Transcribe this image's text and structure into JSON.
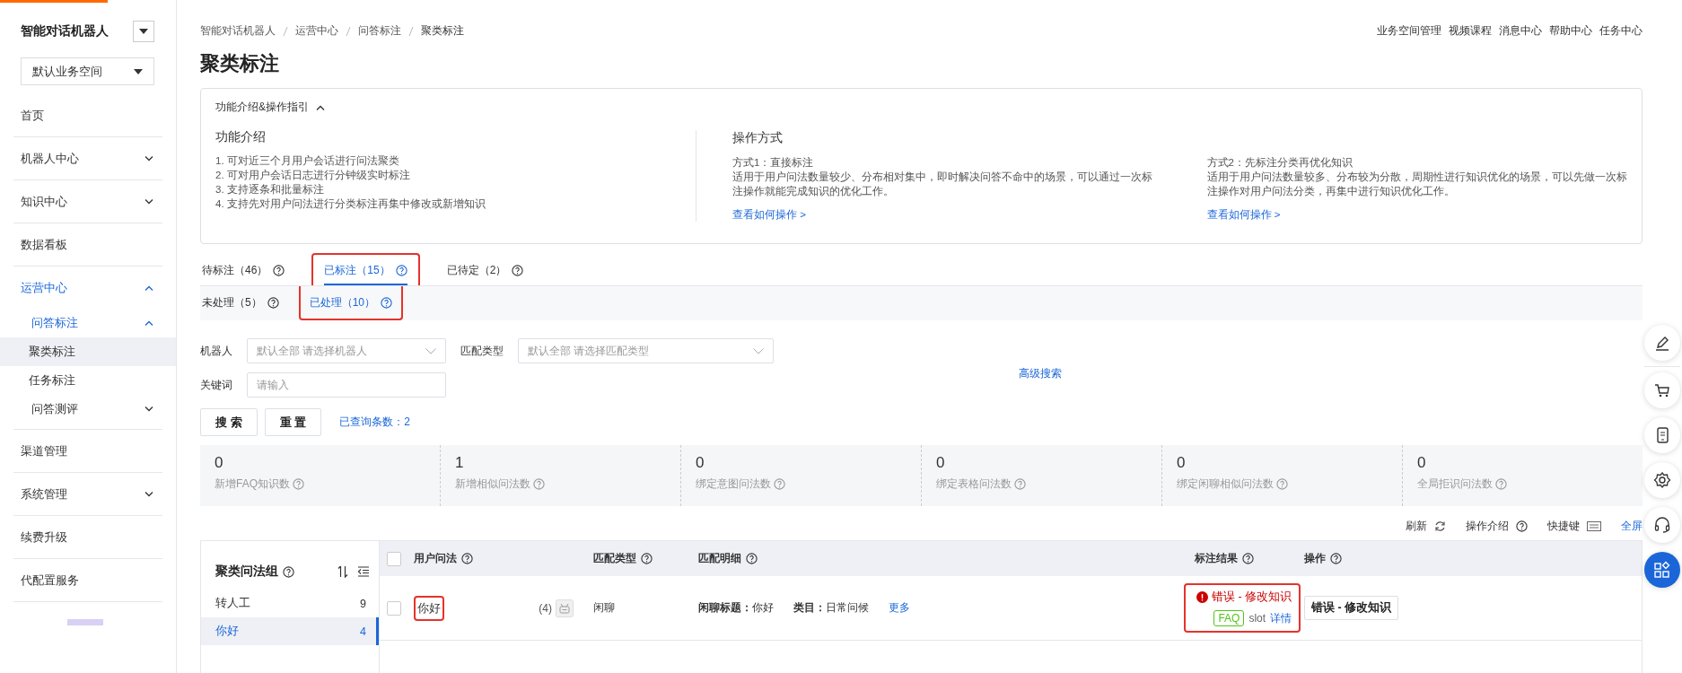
{
  "sidebar": {
    "title": "智能对话机器人",
    "workspace": "默认业务空间",
    "items": [
      {
        "label": "首页",
        "selected": false
      },
      {
        "label": "机器人中心",
        "selected": false,
        "expanded": false
      },
      {
        "label": "知识中心",
        "selected": false,
        "expanded": false
      },
      {
        "label": "数据看板",
        "selected": false
      },
      {
        "label": "运营中心",
        "selected": false,
        "expanded": true,
        "children": [
          {
            "label": "问答标注",
            "selected": false,
            "expanded": true,
            "children": [
              {
                "label": "聚类标注",
                "selected": true
              },
              {
                "label": "任务标注",
                "selected": false
              }
            ]
          },
          {
            "label": "问答测评",
            "selected": false,
            "expanded": false
          }
        ]
      },
      {
        "label": "渠道管理",
        "selected": false
      },
      {
        "label": "系统管理",
        "selected": false,
        "expanded": false
      },
      {
        "label": "续费升级",
        "selected": false
      },
      {
        "label": "代配置服务",
        "selected": false
      }
    ]
  },
  "header": {
    "breadcrumb": [
      "智能对话机器人",
      "运营中心",
      "问答标注",
      "聚类标注"
    ],
    "links": [
      "业务空间管理",
      "视频课程",
      "消息中心",
      "帮助中心",
      "任务中心"
    ],
    "title": "聚类标注"
  },
  "intro": {
    "toggle": "功能介绍&操作指引",
    "expanded": true,
    "features": {
      "title": "功能介绍",
      "lines": [
        "1. 可对近三个月用户会话进行问法聚类",
        "2. 可对用户会话日志进行分钟级实时标注",
        "3. 支持逐条和批量标注",
        "4. 支持先对用户问法进行分类标注再集中修改或新增知识"
      ]
    },
    "operations": {
      "title": "操作方式",
      "methods": [
        {
          "name": "方式1：直接标注",
          "description": "适用于用户问法数量较少、分布相对集中，即时解决问答不命中的场景，可以通过一次标注操作就能完成知识的优化工作。",
          "link": "查看如何操作 >"
        },
        {
          "name": "方式2：先标注分类再优化知识",
          "description": "适用于用户问法数量较多、分布较为分散，周期性进行知识优化的场景，可以先做一次标注操作对用户问法分类，再集中进行知识优化工作。",
          "link": "查看如何操作 >"
        }
      ]
    }
  },
  "tabs": [
    {
      "label": "待标注（46）",
      "selected": false,
      "highlighted": false
    },
    {
      "label": "已标注（15）",
      "selected": true,
      "highlighted": true
    },
    {
      "label": "已待定（2）",
      "selected": false,
      "highlighted": false
    }
  ],
  "subtabs": [
    {
      "label": "未处理（5）",
      "selected": false,
      "highlighted": false
    },
    {
      "label": "已处理（10）",
      "selected": true,
      "highlighted": true
    }
  ],
  "filters": [
    {
      "kind": "select",
      "label": "机器人",
      "placeholder": "默认全部 请选择机器人"
    },
    {
      "kind": "select",
      "label": "匹配类型",
      "placeholder": "默认全部 请选择匹配类型"
    },
    {
      "kind": "text",
      "label": "关键词",
      "placeholder": "请输入"
    }
  ],
  "advanced_search": "高级搜索",
  "buttons": [
    "搜 索",
    "重 置"
  ],
  "result_count": "已查询条数：2",
  "stats": [
    {
      "value": "0",
      "label": "新增FAQ知识数"
    },
    {
      "value": "1",
      "label": "新增相似问法数"
    },
    {
      "value": "0",
      "label": "绑定意图问法数"
    },
    {
      "value": "0",
      "label": "绑定表格问法数"
    },
    {
      "value": "0",
      "label": "绑定闲聊相似问法数"
    },
    {
      "value": "0",
      "label": "全局拒识问法数"
    }
  ],
  "toolbar": [
    {
      "kind": "refresh",
      "label": "刷新"
    },
    {
      "kind": "help",
      "label": "操作介绍"
    },
    {
      "kind": "keyboard",
      "label": "快捷键"
    },
    {
      "kind": "link",
      "label": "全屏"
    }
  ],
  "groups": {
    "title": "聚类问法组",
    "items": [
      {
        "label": "转人工",
        "count": "9",
        "selected": false
      },
      {
        "label": "你好",
        "count": "4",
        "selected": true
      }
    ]
  },
  "table": {
    "all_checked": false,
    "columns": [
      "用户问法",
      "匹配类型",
      "匹配明细",
      "标注结果",
      "操作"
    ],
    "rows": [
      {
        "checked": false,
        "question": "你好",
        "question_highlighted": true,
        "similar_count": "(4)",
        "match_type": "闲聊",
        "details": [
          "**闲聊标题：**你好",
          "**类目：**日常问候"
        ],
        "more": "更多",
        "result": {
          "kind": "error",
          "status": "错误 - 修改知识",
          "tag": "FAQ",
          "slot": "slot",
          "detail": "详情",
          "highlighted": true
        },
        "action": "错误 - 修改知识"
      }
    ]
  }
}
